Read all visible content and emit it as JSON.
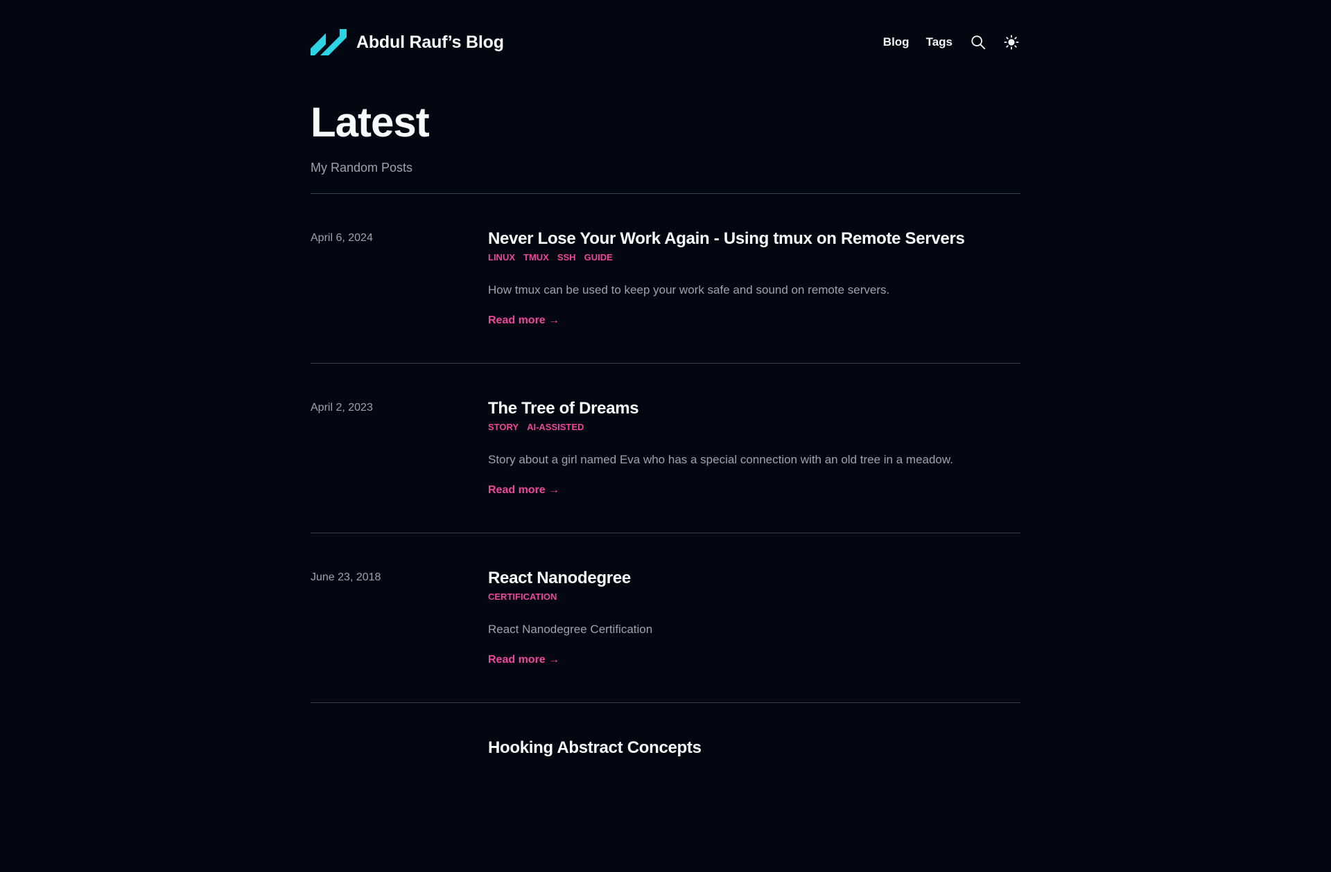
{
  "header": {
    "site_title": "Abdul Rauf’s Blog",
    "nav": {
      "blog": "Blog",
      "tags": "Tags"
    },
    "icons": {
      "search": "search-icon",
      "theme": "sun-icon",
      "logo": "logo-icon"
    }
  },
  "hero": {
    "title": "Latest",
    "subtitle": "My Random Posts"
  },
  "posts": [
    {
      "date": "April 6, 2024",
      "title": "Never Lose Your Work Again - Using tmux on Remote Servers",
      "tags": [
        "LINUX",
        "TMUX",
        "SSH",
        "GUIDE"
      ],
      "summary": "How tmux can be used to keep your work safe and sound on remote servers.",
      "read_more": "Read more →"
    },
    {
      "date": "April 2, 2023",
      "title": "The Tree of Dreams",
      "tags": [
        "STORY",
        "AI-ASSISTED"
      ],
      "summary": "Story about a girl named Eva who has a special connection with an old tree in a meadow.",
      "read_more": "Read more →"
    },
    {
      "date": "June 23, 2018",
      "title": "React Nanodegree",
      "tags": [
        "CERTIFICATION"
      ],
      "summary": "React Nanodegree Certification",
      "read_more": "Read more →"
    },
    {
      "date": "",
      "title": "Hooking Abstract Concepts",
      "tags": [],
      "summary": "",
      "read_more": ""
    }
  ],
  "colors": {
    "background": "#030712",
    "accent": "#ec4899",
    "logo": "#2dd4e4",
    "text_muted": "#9ca3af",
    "divider": "#374151"
  }
}
